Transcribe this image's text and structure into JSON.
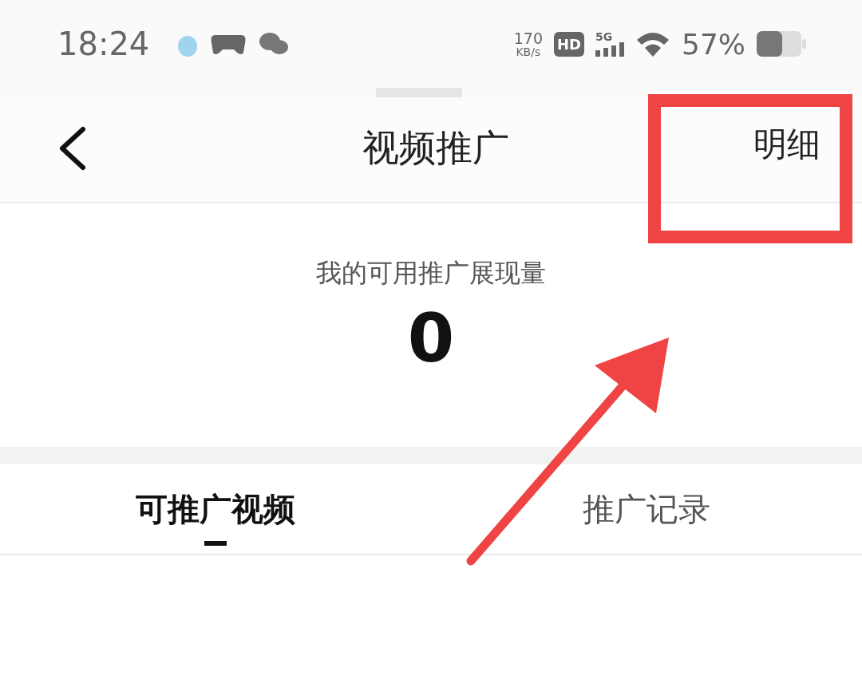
{
  "status_bar": {
    "time": "18:24",
    "net_speed_value": "170",
    "net_speed_unit": "KB/s",
    "hd_badge": "HD",
    "network": "5G",
    "battery": "57%"
  },
  "header": {
    "title": "视频推广",
    "action": "明细"
  },
  "summary": {
    "label": "我的可用推广展现量",
    "value": "0"
  },
  "tabs": [
    {
      "label": "可推广视频",
      "selected": true
    },
    {
      "label": "推广记录",
      "selected": false
    }
  ]
}
